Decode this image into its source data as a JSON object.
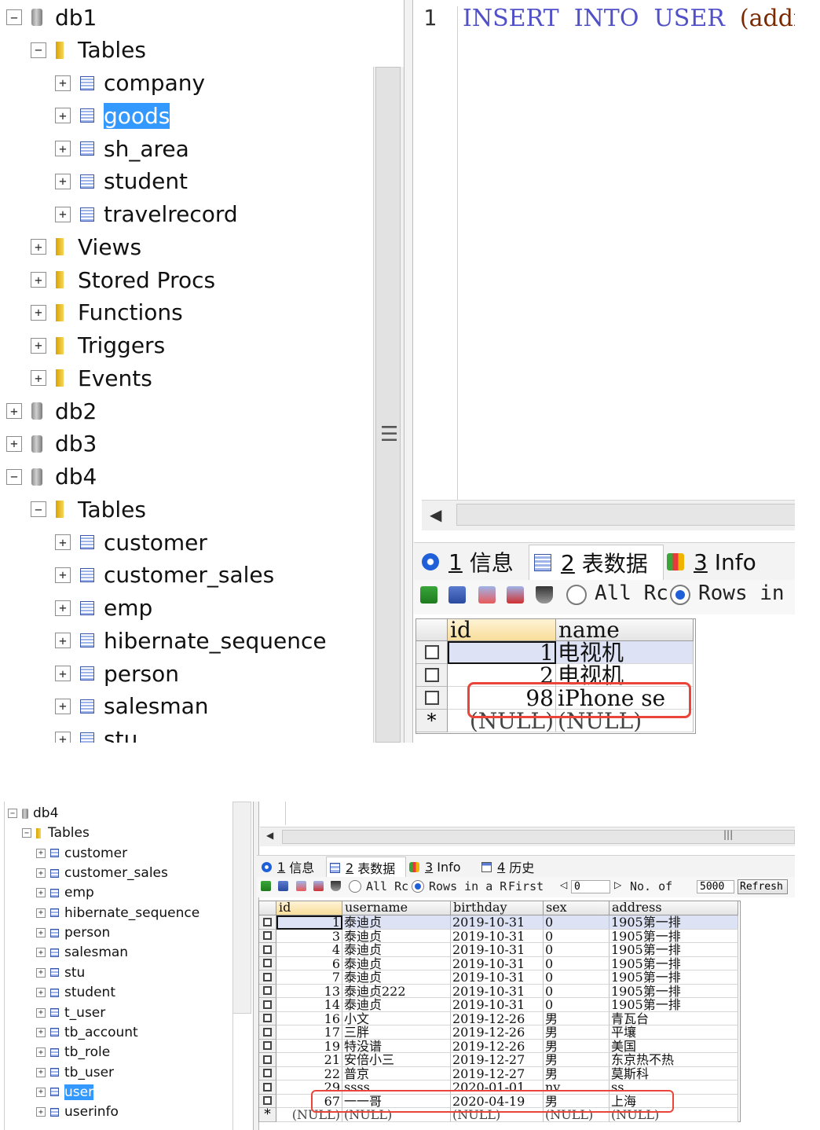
{
  "top": {
    "tree": [
      {
        "level": 0,
        "kind": "db",
        "expanded": true,
        "label": "db1"
      },
      {
        "level": 1,
        "kind": "folder",
        "expanded": true,
        "label": "Tables"
      },
      {
        "level": 2,
        "kind": "table",
        "label": "company"
      },
      {
        "level": 2,
        "kind": "table",
        "label": "goods",
        "selected": true
      },
      {
        "level": 2,
        "kind": "table",
        "label": "sh_area"
      },
      {
        "level": 2,
        "kind": "table",
        "label": "student"
      },
      {
        "level": 2,
        "kind": "table",
        "label": "travelrecord"
      },
      {
        "level": 1,
        "kind": "folder",
        "label": "Views"
      },
      {
        "level": 1,
        "kind": "folder",
        "label": "Stored Procs"
      },
      {
        "level": 1,
        "kind": "folder",
        "label": "Functions"
      },
      {
        "level": 1,
        "kind": "folder",
        "label": "Triggers"
      },
      {
        "level": 1,
        "kind": "folder",
        "label": "Events"
      },
      {
        "level": 0,
        "kind": "db",
        "label": "db2"
      },
      {
        "level": 0,
        "kind": "db",
        "label": "db3"
      },
      {
        "level": 0,
        "kind": "db",
        "expanded": true,
        "label": "db4"
      },
      {
        "level": 1,
        "kind": "folder",
        "expanded": true,
        "label": "Tables"
      },
      {
        "level": 2,
        "kind": "table",
        "label": "customer"
      },
      {
        "level": 2,
        "kind": "table",
        "label": "customer_sales"
      },
      {
        "level": 2,
        "kind": "table",
        "label": "emp"
      },
      {
        "level": 2,
        "kind": "table",
        "label": "hibernate_sequence"
      },
      {
        "level": 2,
        "kind": "table",
        "label": "person"
      },
      {
        "level": 2,
        "kind": "table",
        "label": "salesman"
      },
      {
        "level": 2,
        "kind": "table",
        "label": "stu"
      }
    ],
    "editor": {
      "line_number": "1",
      "sql_keyword1": "INSERT",
      "sql_keyword2": "INTO",
      "sql_table": "USER",
      "sql_rest": "(addr"
    },
    "tabs": [
      {
        "num": "1",
        "label": "信息",
        "icon": "info-icon"
      },
      {
        "num": "2",
        "label": "表数据",
        "icon": "table-icon",
        "active": true
      },
      {
        "num": "3",
        "label": "Info",
        "icon": "chart-icon"
      }
    ],
    "toolbar": {
      "radio_all": "All Rc",
      "radio_rows": "Rows in a"
    },
    "grid": {
      "columns": [
        "id",
        "name"
      ],
      "rows": [
        {
          "id": "1",
          "name": "电视机"
        },
        {
          "id": "2",
          "name": "电视机"
        },
        {
          "id": "98",
          "name": "iPhone se"
        }
      ],
      "new_row_marker": "*",
      "null_text": "(NULL)",
      "highlighted_row": "98"
    }
  },
  "bottom": {
    "tree": [
      {
        "level": 0,
        "kind": "db",
        "expanded": true,
        "label": "db4"
      },
      {
        "level": 1,
        "kind": "folder",
        "expanded": true,
        "label": "Tables"
      },
      {
        "level": 2,
        "kind": "table",
        "label": "customer"
      },
      {
        "level": 2,
        "kind": "table",
        "label": "customer_sales"
      },
      {
        "level": 2,
        "kind": "table",
        "label": "emp"
      },
      {
        "level": 2,
        "kind": "table",
        "label": "hibernate_sequence"
      },
      {
        "level": 2,
        "kind": "table",
        "label": "person"
      },
      {
        "level": 2,
        "kind": "table",
        "label": "salesman"
      },
      {
        "level": 2,
        "kind": "table",
        "label": "stu"
      },
      {
        "level": 2,
        "kind": "table",
        "label": "student"
      },
      {
        "level": 2,
        "kind": "table",
        "label": "t_user"
      },
      {
        "level": 2,
        "kind": "table",
        "label": "tb_account"
      },
      {
        "level": 2,
        "kind": "table",
        "label": "tb_role"
      },
      {
        "level": 2,
        "kind": "table",
        "label": "tb_user"
      },
      {
        "level": 2,
        "kind": "table",
        "label": "user",
        "selected": true
      },
      {
        "level": 2,
        "kind": "table",
        "label": "userinfo"
      }
    ],
    "tabs": [
      {
        "num": "1",
        "label": "信息",
        "icon": "info-icon"
      },
      {
        "num": "2",
        "label": "表数据",
        "icon": "table-icon",
        "active": true
      },
      {
        "num": "3",
        "label": "Info",
        "icon": "chart-icon"
      },
      {
        "num": "4",
        "label": "历史",
        "icon": "history-icon"
      }
    ],
    "toolbar": {
      "radio_all": "All Rc",
      "radio_rows": "Rows in a R",
      "first_label": "First",
      "first_value": "0",
      "no_of_label": "No. of",
      "no_of_value": "5000",
      "refresh_label": "Refresh"
    },
    "grid": {
      "columns": [
        "id",
        "username",
        "birthday",
        "sex",
        "address"
      ],
      "rows": [
        {
          "id": "1",
          "username": "泰迪贞",
          "birthday": "2019-10-31",
          "sex": "0",
          "address": "1905第一排"
        },
        {
          "id": "3",
          "username": "泰迪贞",
          "birthday": "2019-10-31",
          "sex": "0",
          "address": "1905第一排"
        },
        {
          "id": "4",
          "username": "泰迪贞",
          "birthday": "2019-10-31",
          "sex": "0",
          "address": "1905第一排"
        },
        {
          "id": "6",
          "username": "泰迪贞",
          "birthday": "2019-10-31",
          "sex": "0",
          "address": "1905第一排"
        },
        {
          "id": "7",
          "username": "泰迪贞",
          "birthday": "2019-10-31",
          "sex": "0",
          "address": "1905第一排"
        },
        {
          "id": "13",
          "username": "泰迪贞222",
          "birthday": "2019-10-31",
          "sex": "0",
          "address": "1905第一排"
        },
        {
          "id": "14",
          "username": "泰迪贞",
          "birthday": "2019-10-31",
          "sex": "0",
          "address": "1905第一排"
        },
        {
          "id": "16",
          "username": "小文",
          "birthday": "2019-12-26",
          "sex": "男",
          "address": "青瓦台"
        },
        {
          "id": "17",
          "username": "三胖",
          "birthday": "2019-12-26",
          "sex": "男",
          "address": "平壤"
        },
        {
          "id": "19",
          "username": "特没谱",
          "birthday": "2019-12-26",
          "sex": "男",
          "address": "美国"
        },
        {
          "id": "21",
          "username": "安倍小三",
          "birthday": "2019-12-27",
          "sex": "男",
          "address": "东京热不热"
        },
        {
          "id": "22",
          "username": "普京",
          "birthday": "2019-12-27",
          "sex": "男",
          "address": "莫斯科"
        },
        {
          "id": "29",
          "username": "ssss",
          "birthday": "2020-01-01",
          "sex": "nv",
          "address": "ss"
        },
        {
          "id": "67",
          "username": "一一哥",
          "birthday": "2020-04-19",
          "sex": "男",
          "address": "上海"
        }
      ],
      "new_row_marker": "*",
      "null_text": "(NULL)",
      "highlighted_row": "67"
    }
  }
}
